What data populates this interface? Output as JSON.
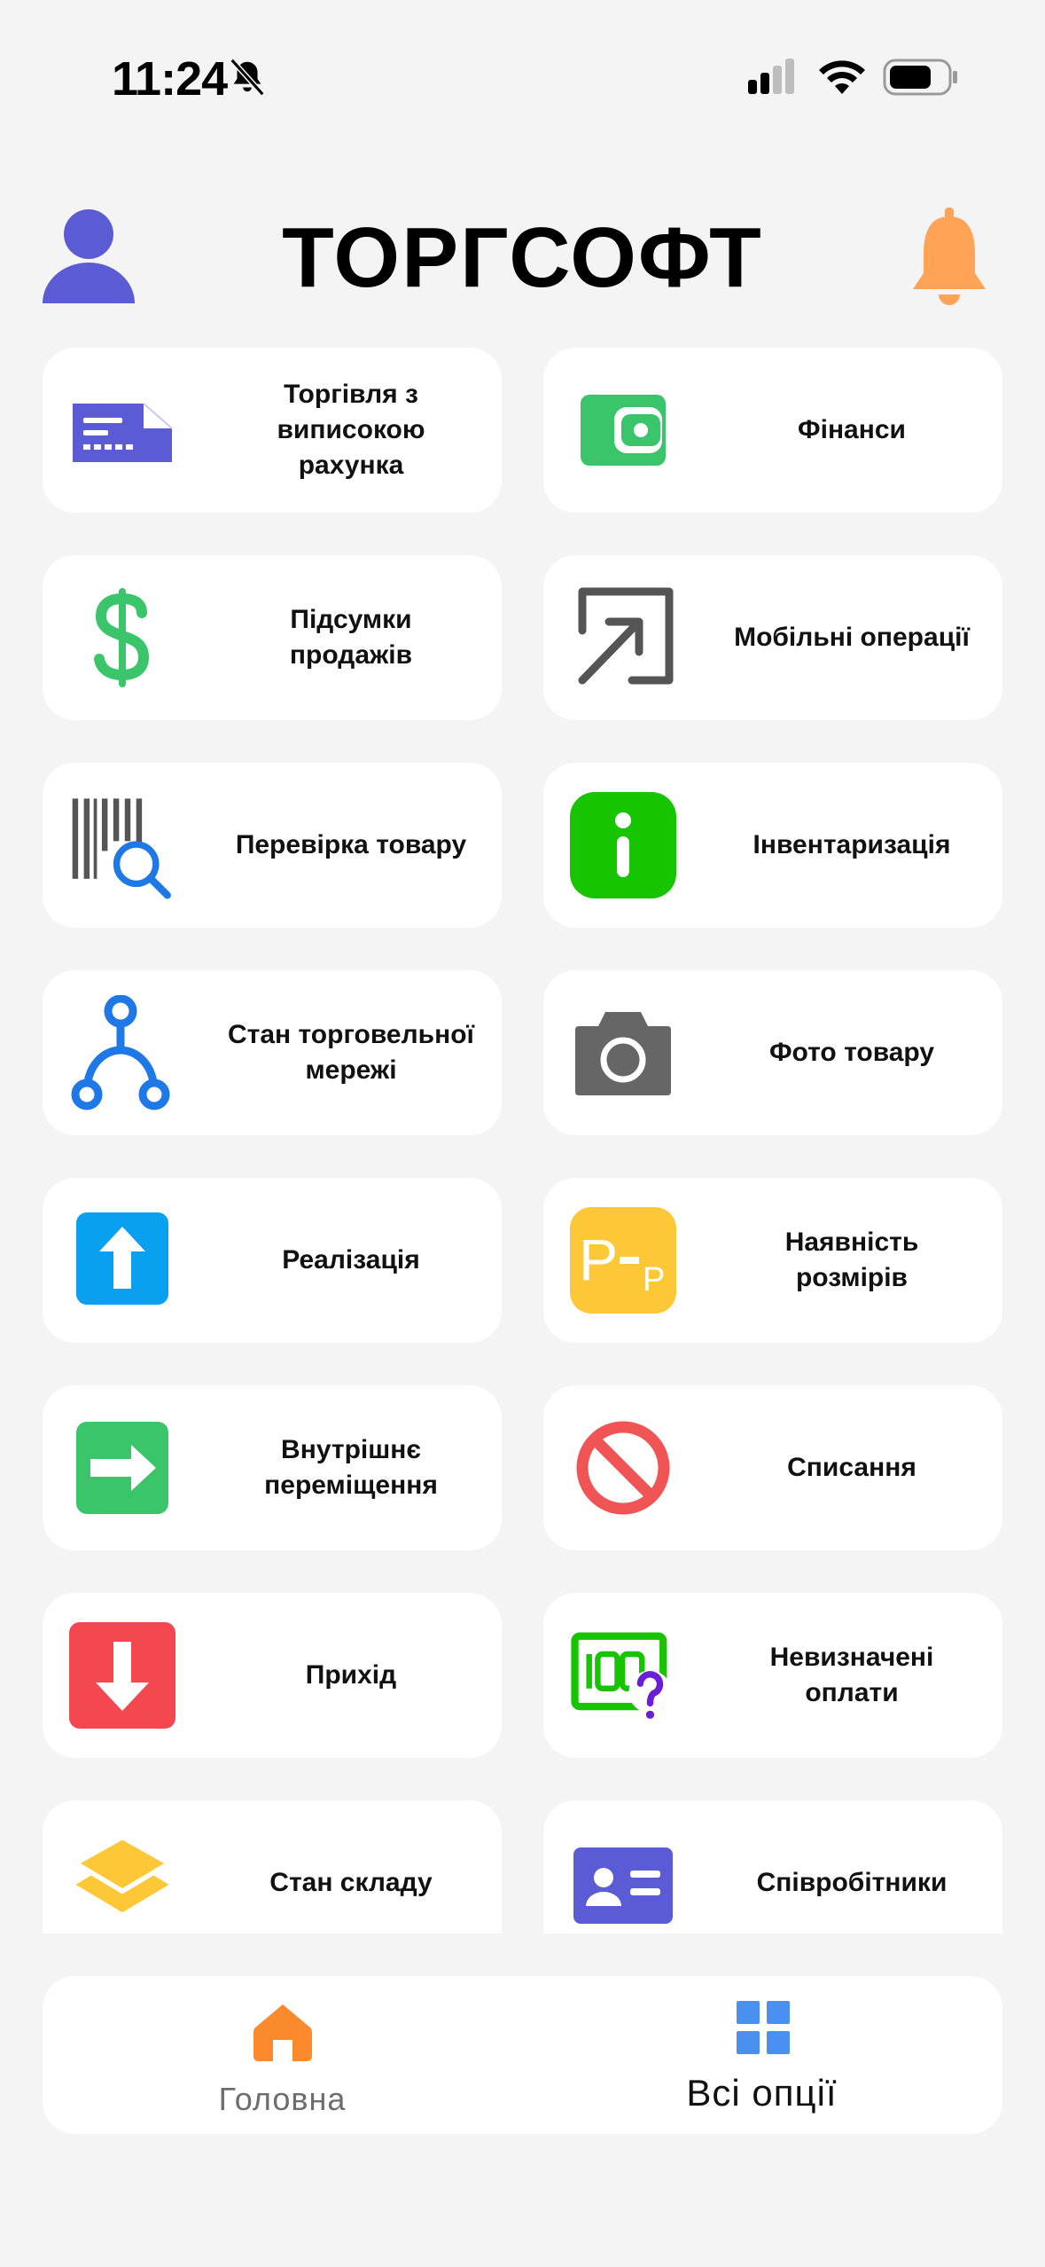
{
  "status_bar": {
    "time": "11:24"
  },
  "header": {
    "title": "ТОРГСОФТ"
  },
  "colors": {
    "avatar": "#5b5bd6",
    "bell": "#ffa357",
    "card_bg": "#ffffff",
    "page_bg": "#f4f4f4",
    "home_active": "#fa8a2b",
    "grid_icon": "#4a90f0"
  },
  "menu": [
    {
      "label": "Торгівля з\nвиписокою\nрахунка",
      "icon": "receipt-icon"
    },
    {
      "label": "Фінанси",
      "icon": "wallet-icon"
    },
    {
      "label": "Підсумки\nпродажів",
      "icon": "dollar-icon"
    },
    {
      "label": "Мобільні операції",
      "icon": "arrow-box-icon"
    },
    {
      "label": "Перевірка товару",
      "icon": "barcode-search-icon"
    },
    {
      "label": "Інвентаризація",
      "icon": "info-icon"
    },
    {
      "label": "Стан торговельної\nмережі",
      "icon": "network-icon"
    },
    {
      "label": "Фото товару",
      "icon": "camera-icon"
    },
    {
      "label": "Реалізація",
      "icon": "arrow-up-icon"
    },
    {
      "label": "Наявність\nрозмірів",
      "icon": "sizes-icon"
    },
    {
      "label": "Внутрішнє\nпереміщення",
      "icon": "arrow-right-icon"
    },
    {
      "label": "Списання",
      "icon": "prohibited-icon"
    },
    {
      "label": "Прихід",
      "icon": "arrow-down-icon"
    },
    {
      "label": "Невизначені\nоплати",
      "icon": "unknown-payment-icon"
    },
    {
      "label": "Стан складу",
      "icon": "layers-icon"
    },
    {
      "label": "Співробітники",
      "icon": "id-card-icon"
    }
  ],
  "bottom_nav": {
    "home_label": "Головна",
    "all_label": "Всі опції"
  }
}
